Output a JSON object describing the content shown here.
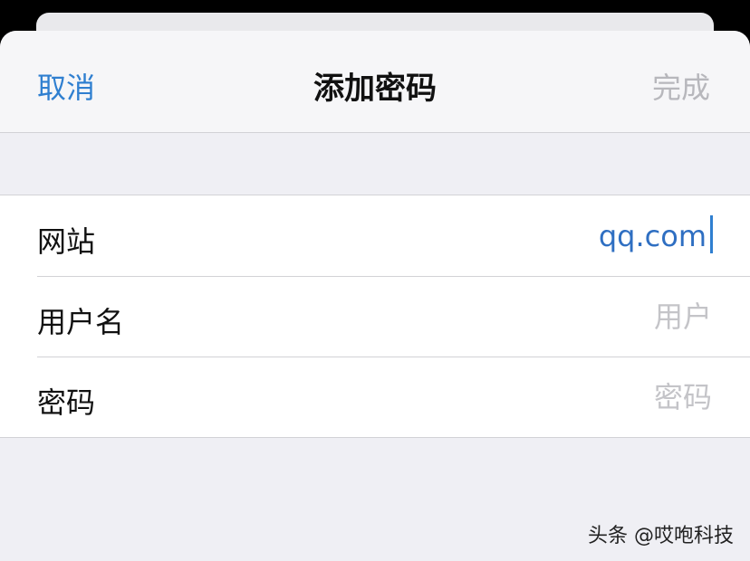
{
  "nav": {
    "cancel_label": "取消",
    "title": "添加密码",
    "done_label": "完成"
  },
  "form": {
    "website": {
      "label": "网站",
      "value": "qq.com",
      "placeholder": ""
    },
    "username": {
      "label": "用户名",
      "value": "",
      "placeholder": "用户"
    },
    "password": {
      "label": "密码",
      "value": "",
      "placeholder": "密码"
    }
  },
  "watermark": "头条 @哎咆科技",
  "colors": {
    "accent": "#2f7fd0",
    "disabled": "#b7b7bc",
    "placeholder": "#c4c4c8",
    "grouped_background": "#efeff4"
  }
}
